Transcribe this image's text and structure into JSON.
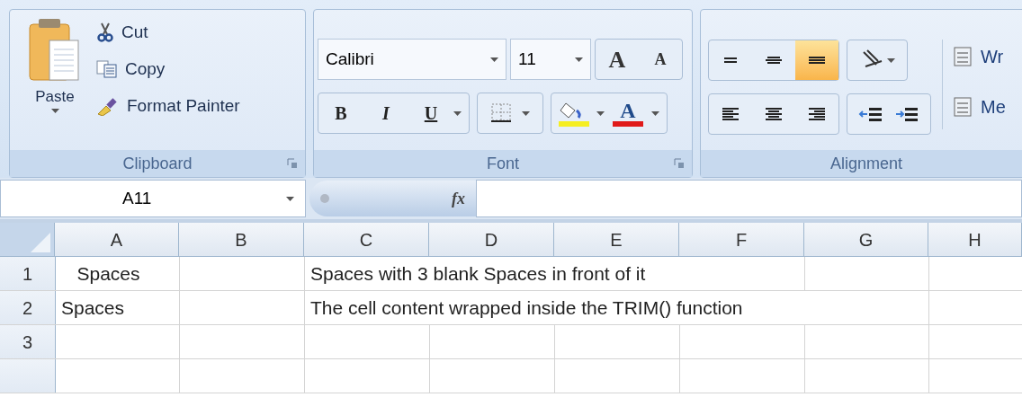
{
  "ribbon": {
    "groups": [
      {
        "kind": "clipboard",
        "label": "Clipboard",
        "paste": "Paste",
        "commands": [
          {
            "kind": "cut",
            "label": "Cut"
          },
          {
            "kind": "copy",
            "label": "Copy"
          },
          {
            "kind": "painter",
            "label": "Format Painter"
          }
        ]
      },
      {
        "kind": "font",
        "label": "Font",
        "font_name": "Calibri",
        "font_size": "11",
        "grow": "A",
        "shrink": "A",
        "styles": [
          {
            "kind": "bold",
            "label": "B"
          },
          {
            "kind": "italic",
            "label": "I"
          },
          {
            "kind": "underline",
            "label": "U"
          }
        ],
        "font_color": "A"
      },
      {
        "kind": "alignment",
        "label": "Alignment",
        "vertical": [
          {
            "kind": "top",
            "selected": false
          },
          {
            "kind": "middle",
            "selected": false
          },
          {
            "kind": "bottom",
            "selected": true
          }
        ],
        "horizontal": [
          {
            "kind": "left",
            "selected": false
          },
          {
            "kind": "center",
            "selected": false
          },
          {
            "kind": "right",
            "selected": false
          }
        ],
        "commands": [
          {
            "kind": "wrap",
            "label": "Wr"
          },
          {
            "kind": "merge",
            "label": "Me"
          }
        ]
      }
    ]
  },
  "formula_bar": {
    "name_box": "A11",
    "fx": "fx"
  },
  "sheet": {
    "columns": [
      "A",
      "B",
      "C",
      "D",
      "E",
      "F",
      "G",
      "H"
    ],
    "rows": [
      {
        "header": "1",
        "A": "   Spaces",
        "C": "Spaces with 3 blank Spaces in front of it"
      },
      {
        "header": "2",
        "A": "Spaces",
        "C": "The cell content wrapped inside the TRIM() function"
      },
      {
        "header": "3"
      }
    ]
  }
}
